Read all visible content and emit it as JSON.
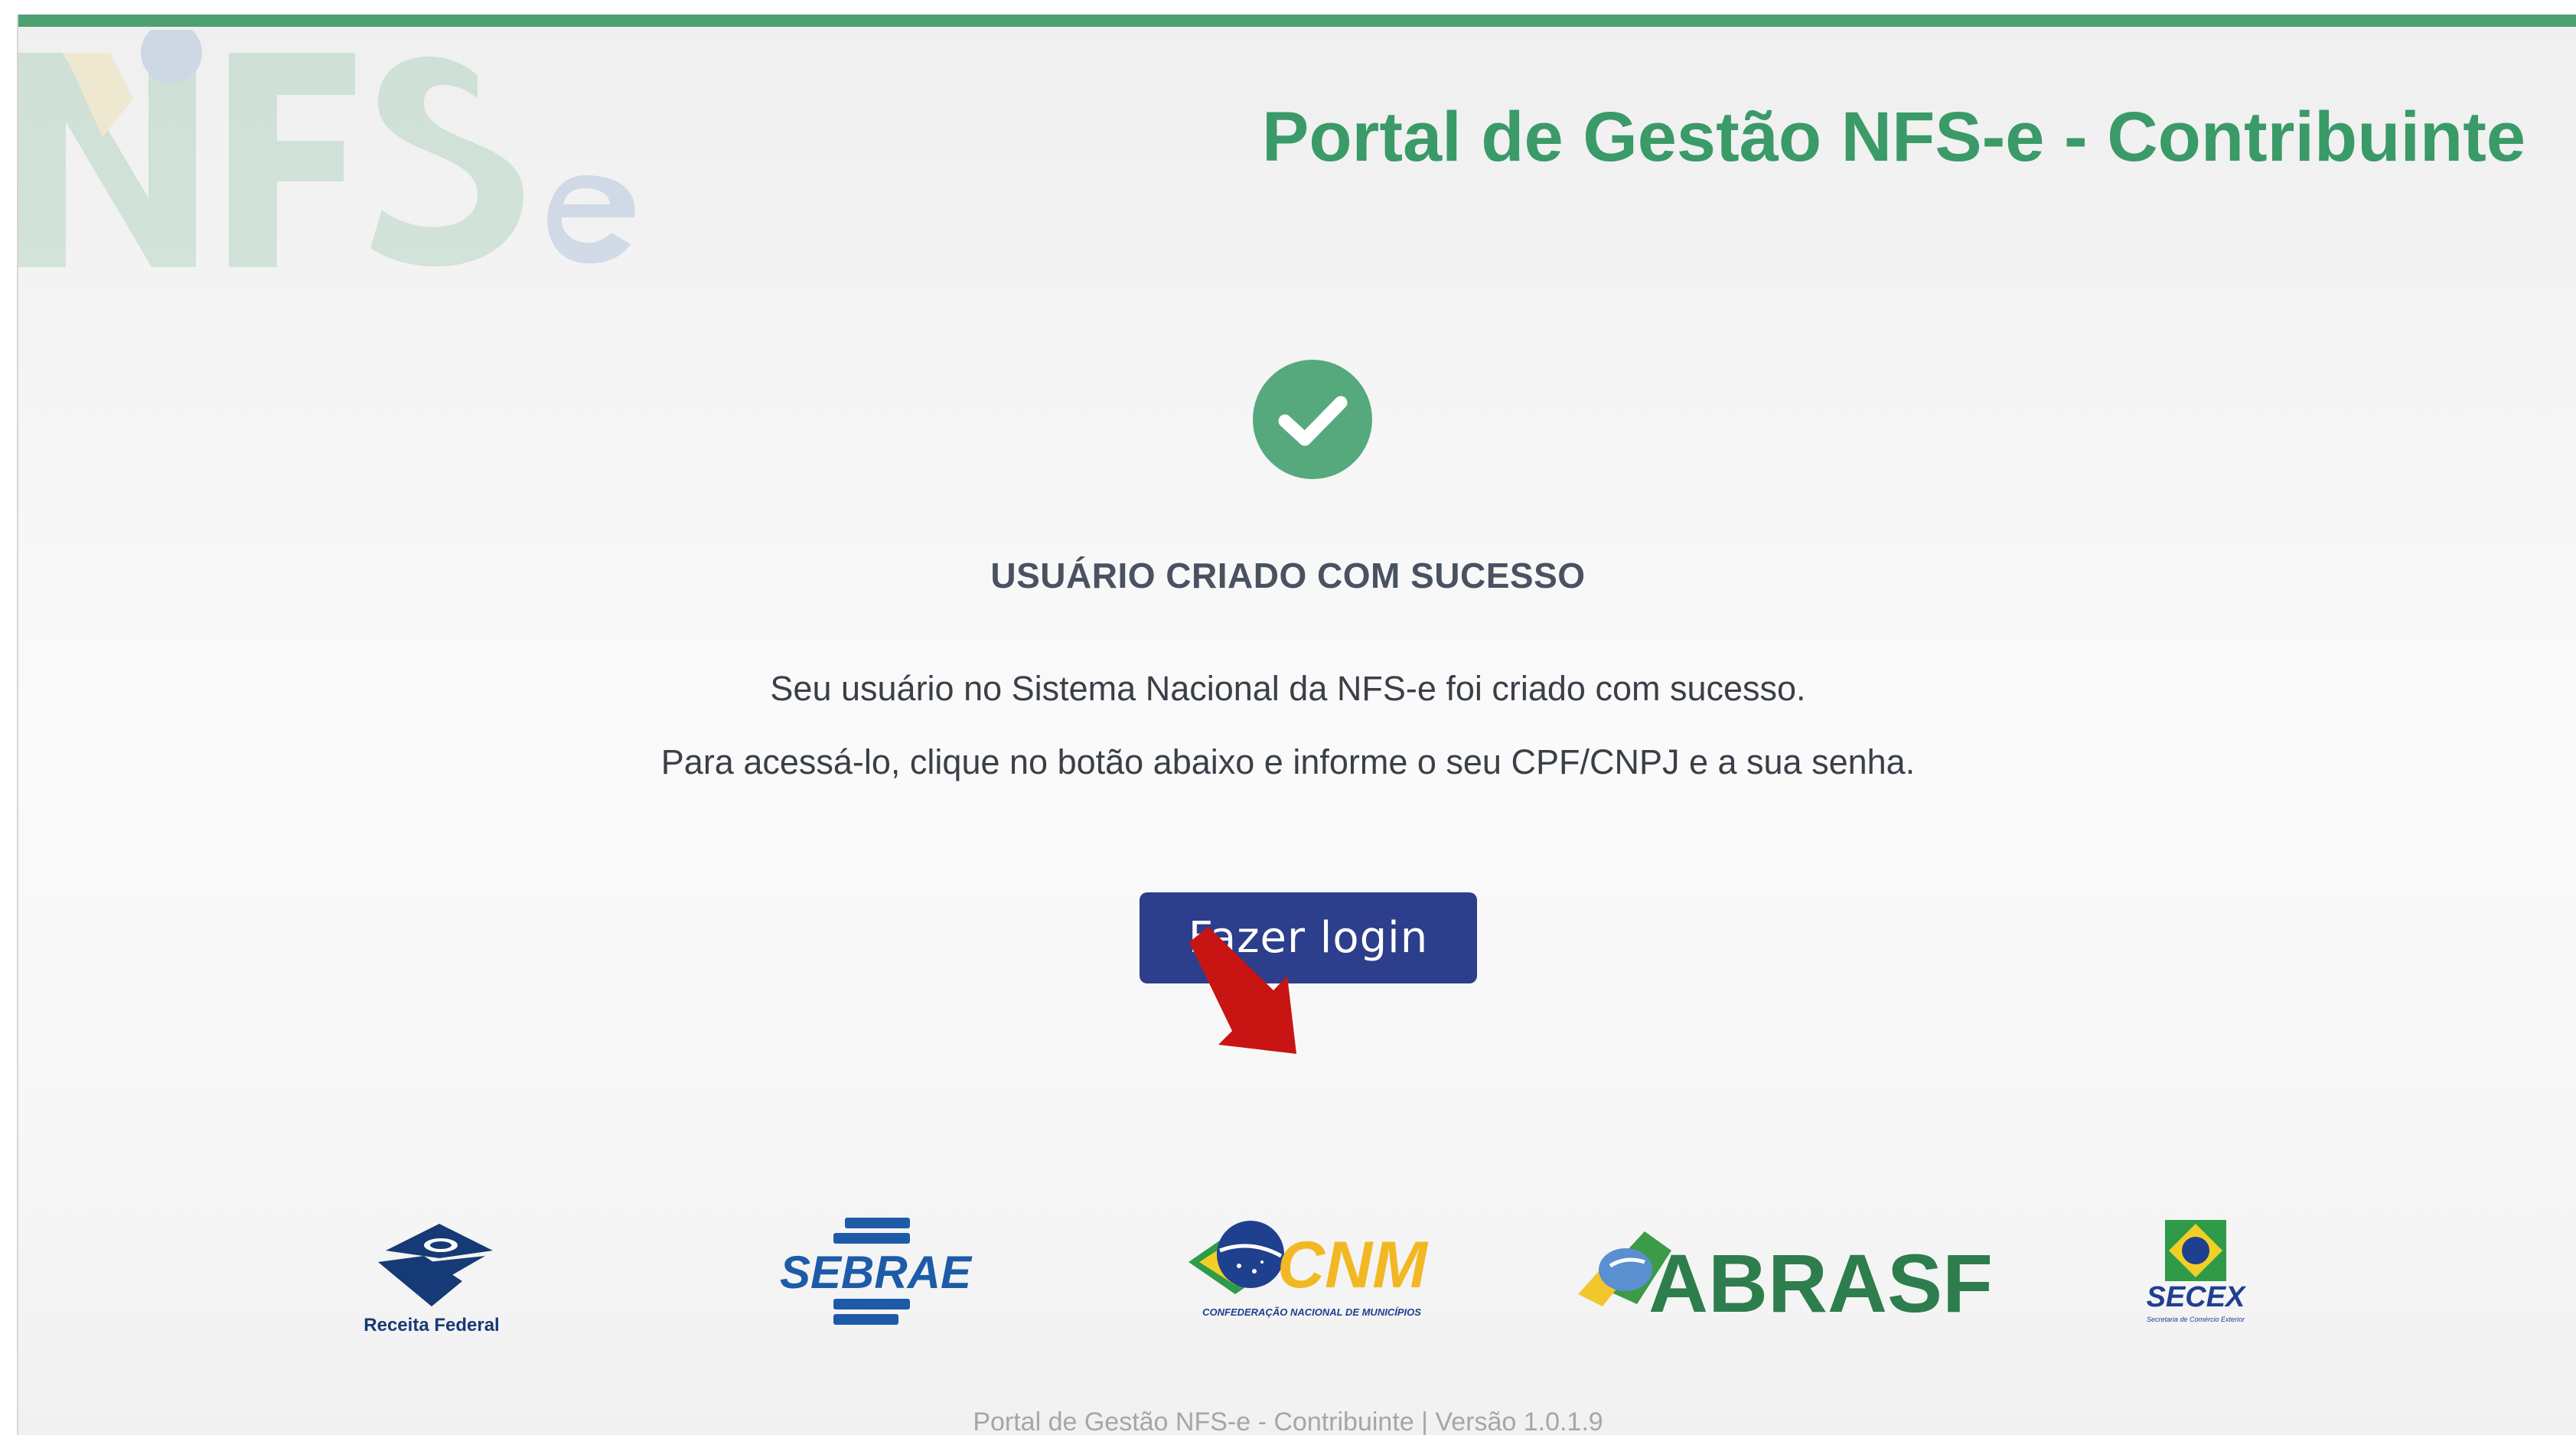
{
  "header": {
    "watermark_logo": "NFSe",
    "title": "Portal de Gestão NFS-e - Contribuinte",
    "accent_color": "#4e9f72",
    "title_color": "#3a9a68"
  },
  "main": {
    "status_icon": "check-circle-icon",
    "status_icon_color": "#4e9f72",
    "heading": "USUÁRIO CRIADO COM SUCESSO",
    "message_line_1": "Seu usuário no Sistema Nacional da NFS-e foi criado com sucesso.",
    "message_line_2": "Para acessá-lo, clique no botão abaixo e informe o seu CPF/CNPJ e a sua senha.",
    "login_button_label": "Fazer login",
    "login_button_color": "#2c3e8c",
    "annotation_arrow_color": "#cc1111"
  },
  "partners": {
    "logos": [
      {
        "name": "Receita Federal",
        "icon": "receita-federal-logo"
      },
      {
        "name": "SEBRAE",
        "icon": "sebrae-logo"
      },
      {
        "name": "CNM",
        "subtitle": "CONFEDERAÇÃO NACIONAL DE MUNICÍPIOS",
        "icon": "cnm-logo"
      },
      {
        "name": "ABRASF",
        "icon": "abrasf-logo"
      },
      {
        "name": "SECEX",
        "subtitle": "Secretaria de Comércio Exterior",
        "icon": "secex-logo"
      }
    ]
  },
  "footer": {
    "text": "Portal de Gestão NFS-e - Contribuinte | Versão 1.0.1.9"
  }
}
